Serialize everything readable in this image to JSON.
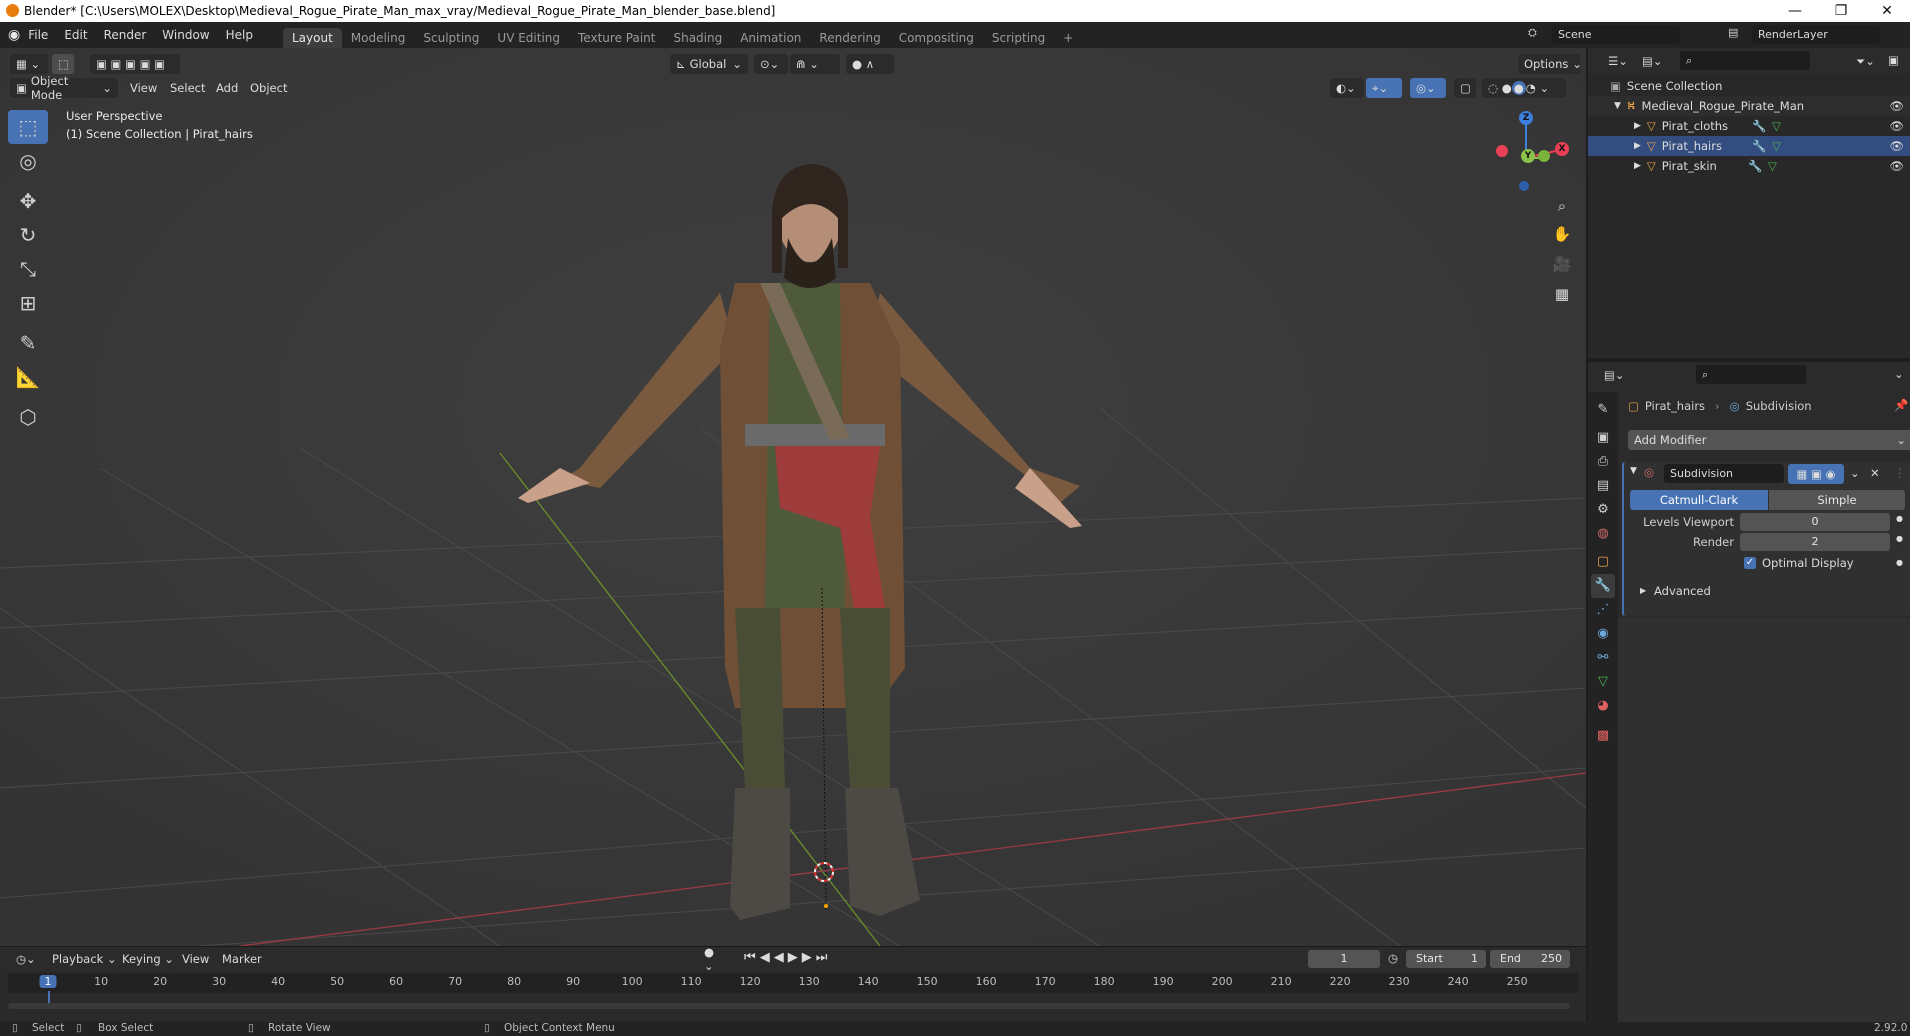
{
  "window": {
    "title": "Blender* [C:\\Users\\MOLEX\\Desktop\\Medieval_Rogue_Pirate_Man_max_vray/Medieval_Rogue_Pirate_Man_blender_base.blend]",
    "minimize": "—",
    "restore": "❐",
    "close": "✕"
  },
  "menubar": {
    "items": [
      "File",
      "Edit",
      "Render",
      "Window",
      "Help"
    ],
    "workspaces": [
      "Layout",
      "Modeling",
      "Sculpting",
      "UV Editing",
      "Texture Paint",
      "Shading",
      "Animation",
      "Rendering",
      "Compositing",
      "Scripting"
    ],
    "active_workspace": "Layout",
    "add_tab": "+",
    "scene": "Scene",
    "render_layer": "RenderLayer"
  },
  "viewport_header": {
    "mode": "Object Mode",
    "menus": [
      "View",
      "Select",
      "Add",
      "Object"
    ],
    "orientation": "Global",
    "options": "Options"
  },
  "viewport": {
    "perspective": "User Perspective",
    "collection_info": "(1) Scene Collection | Pirat_hairs",
    "gizmo": {
      "x": "X",
      "y": "Y",
      "z": "Z"
    }
  },
  "outliner": {
    "root": "Scene Collection",
    "collection": "Medieval_Rogue_Pirate_Man",
    "objects": [
      "Pirat_cloths",
      "Pirat_hairs",
      "Pirat_skin"
    ]
  },
  "properties": {
    "object": "Pirat_hairs",
    "modifier_context": "Subdivision",
    "add_modifier": "Add Modifier",
    "modifier": {
      "name": "Subdivision",
      "type_options": [
        "Catmull-Clark",
        "Simple"
      ],
      "active_type": "Catmull-Clark",
      "levels_viewport_label": "Levels Viewport",
      "levels_viewport": "0",
      "render_label": "Render",
      "render": "2",
      "optimal_display_label": "Optimal Display",
      "optimal_display": true,
      "advanced": "Advanced"
    }
  },
  "timeline": {
    "menus": [
      "Playback",
      "Keying",
      "View",
      "Marker"
    ],
    "current_frame": "1",
    "start_label": "Start",
    "start": "1",
    "end_label": "End",
    "end": "250",
    "ticks": [
      "1",
      "10",
      "20",
      "30",
      "40",
      "50",
      "60",
      "70",
      "80",
      "90",
      "100",
      "110",
      "120",
      "130",
      "140",
      "150",
      "160",
      "170",
      "180",
      "190",
      "200",
      "210",
      "220",
      "230",
      "240",
      "250"
    ]
  },
  "statusbar": {
    "select": "Select",
    "box_select": "Box Select",
    "rotate_view": "Rotate View",
    "context_menu": "Object Context Menu",
    "version": "2.92.0"
  },
  "colors": {
    "accent": "#4772b3",
    "viewport_bg": "#393939",
    "x_axis": "#e84156",
    "y_axis": "#8bc34a",
    "z_axis": "#3d7fdc"
  }
}
